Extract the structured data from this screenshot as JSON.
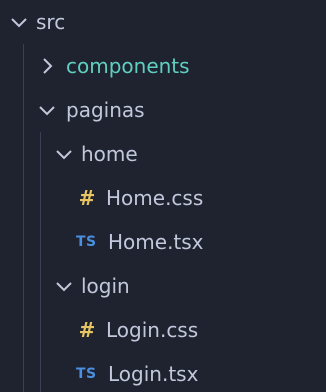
{
  "tree": {
    "root": {
      "label": "src",
      "expanded": true,
      "icon": "chevron-down-icon"
    },
    "components": {
      "label": "components",
      "expanded": false,
      "icon": "chevron-right-icon",
      "color": "#5fd0c0"
    },
    "paginas": {
      "label": "paginas",
      "expanded": true,
      "icon": "chevron-down-icon"
    },
    "home": {
      "label": "home",
      "expanded": true,
      "icon": "chevron-down-icon"
    },
    "home_css": {
      "label": "Home.css",
      "badge": "#",
      "icon": "css-file-icon",
      "badge_color": "#e7c563"
    },
    "home_tsx": {
      "label": "Home.tsx",
      "badge": "TS",
      "icon": "typescript-file-icon",
      "badge_color": "#4a8fe0"
    },
    "login": {
      "label": "login",
      "expanded": true,
      "icon": "chevron-down-icon"
    },
    "login_css": {
      "label": "Login.css",
      "badge": "#",
      "icon": "css-file-icon",
      "badge_color": "#e7c563"
    },
    "login_tsx": {
      "label": "Login.tsx",
      "badge": "TS",
      "icon": "typescript-file-icon",
      "badge_color": "#4a8fe0"
    }
  }
}
